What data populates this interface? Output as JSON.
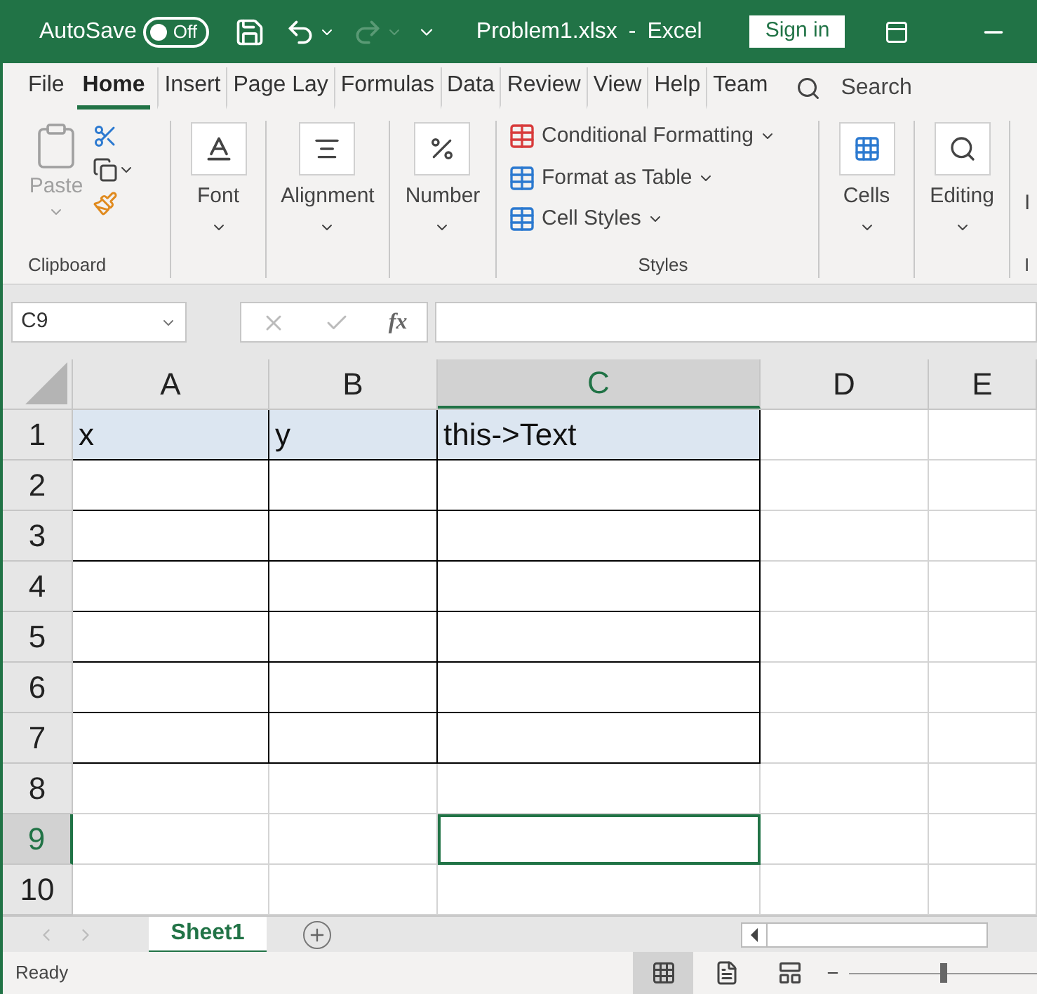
{
  "title_bar": {
    "autosave_label": "AutoSave",
    "autosave": {
      "label": "Off",
      "on": false
    },
    "file_name": "Problem1.xlsx",
    "separator": "-",
    "app_name": "Excel",
    "sign_in": "Sign in"
  },
  "ribbon_tabs": [
    {
      "label": "File",
      "selected": false
    },
    {
      "label": "Home",
      "selected": true
    },
    {
      "label": "Insert",
      "selected": false
    },
    {
      "label": "Page Lay",
      "selected": false
    },
    {
      "label": "Formulas",
      "selected": false
    },
    {
      "label": "Data",
      "selected": false
    },
    {
      "label": "Review",
      "selected": false
    },
    {
      "label": "View",
      "selected": false
    },
    {
      "label": "Help",
      "selected": false
    },
    {
      "label": "Team",
      "selected": false
    }
  ],
  "search": {
    "placeholder": "Search"
  },
  "ribbon": {
    "clipboard": {
      "paste": "Paste",
      "label": "Clipboard"
    },
    "big_buttons": [
      {
        "kind": "font",
        "label": "Font"
      },
      {
        "kind": "alignment",
        "label": "Alignment"
      },
      {
        "kind": "number",
        "label": "Number"
      }
    ],
    "styles": {
      "items": [
        {
          "kind": "conditional",
          "label": "Conditional Formatting"
        },
        {
          "kind": "table",
          "label": "Format as Table"
        },
        {
          "kind": "cellstyles",
          "label": "Cell Styles"
        }
      ],
      "label": "Styles"
    },
    "tail_buttons": [
      {
        "kind": "cells",
        "label": "Cells"
      },
      {
        "kind": "editing",
        "label": "Editing"
      }
    ],
    "cut_button": "I",
    "cut_group": "I"
  },
  "name_box": "C9",
  "function_symbol": "fx",
  "columns": [
    {
      "label": "A",
      "selected": false
    },
    {
      "label": "B",
      "selected": false
    },
    {
      "label": "C",
      "selected": true
    },
    {
      "label": "D",
      "selected": false
    },
    {
      "label": "E",
      "selected": false
    }
  ],
  "rows": [
    {
      "label": "1",
      "selected": false,
      "filled": true,
      "bordered": true,
      "cells": [
        "x",
        "y",
        "this->Text"
      ]
    },
    {
      "label": "2",
      "selected": false,
      "filled": false,
      "bordered": true
    },
    {
      "label": "3",
      "selected": false,
      "filled": false,
      "bordered": true
    },
    {
      "label": "4",
      "selected": false,
      "filled": false,
      "bordered": true
    },
    {
      "label": "5",
      "selected": false,
      "filled": false,
      "bordered": true
    },
    {
      "label": "6",
      "selected": false,
      "filled": false,
      "bordered": true
    },
    {
      "label": "7",
      "selected": false,
      "filled": false,
      "bordered": true
    },
    {
      "label": "8",
      "selected": false,
      "filled": false,
      "bordered": false
    },
    {
      "label": "9",
      "selected": true,
      "filled": false,
      "bordered": false
    },
    {
      "label": "10",
      "selected": false,
      "filled": false,
      "bordered": false
    }
  ],
  "sheet_tabs": [
    {
      "label": "Sheet1",
      "selected": true
    }
  ],
  "status_bar": {
    "status": "Ready",
    "zoom": {
      "level": 0.5
    }
  }
}
